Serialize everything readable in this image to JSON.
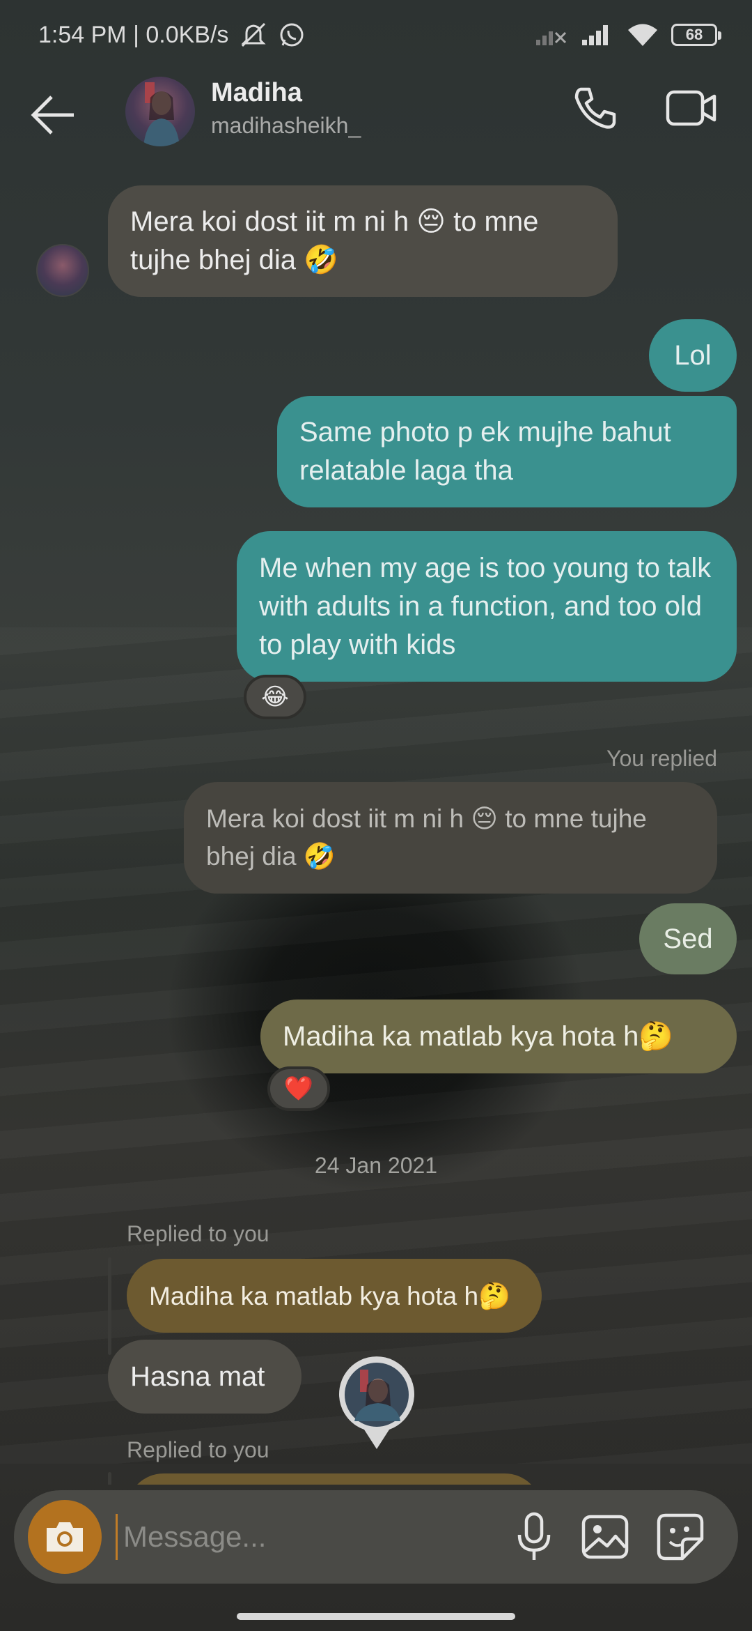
{
  "status_bar": {
    "time_speed": "1:54 PM | 0.0KB/s",
    "battery": "68"
  },
  "header": {
    "name": "Madiha",
    "username": "madihasheikh_"
  },
  "messages": {
    "m1": "Mera koi dost iit m ni h 😔 to mne tujhe bhej dia 🤣",
    "m2": "Lol",
    "m3": "Same photo p ek mujhe bahut relatable laga tha",
    "m4": "Me when my age is too young to talk with adults in a function, and too old to play with kids",
    "m4_reaction": "😂",
    "reply_label_1": "You replied",
    "m5_quoted": "Mera koi dost iit m ni h 😔 to mne tujhe bhej dia 🤣",
    "m6": "Sed",
    "m7": "Madiha ka matlab kya hota h🤔",
    "m7_reaction": "❤️",
    "date": "24 Jan 2021",
    "reply_label_2": "Replied to you",
    "m8_quoted": "Madiha ka matlab kya hota h🤔",
    "m9": "Hasna mat",
    "reply_label_3": "Replied to you"
  },
  "composer": {
    "placeholder": "Message..."
  },
  "colors": {
    "accent": "#b3721f",
    "outgoing": "#3a918f",
    "incoming": "#4e4c46"
  }
}
